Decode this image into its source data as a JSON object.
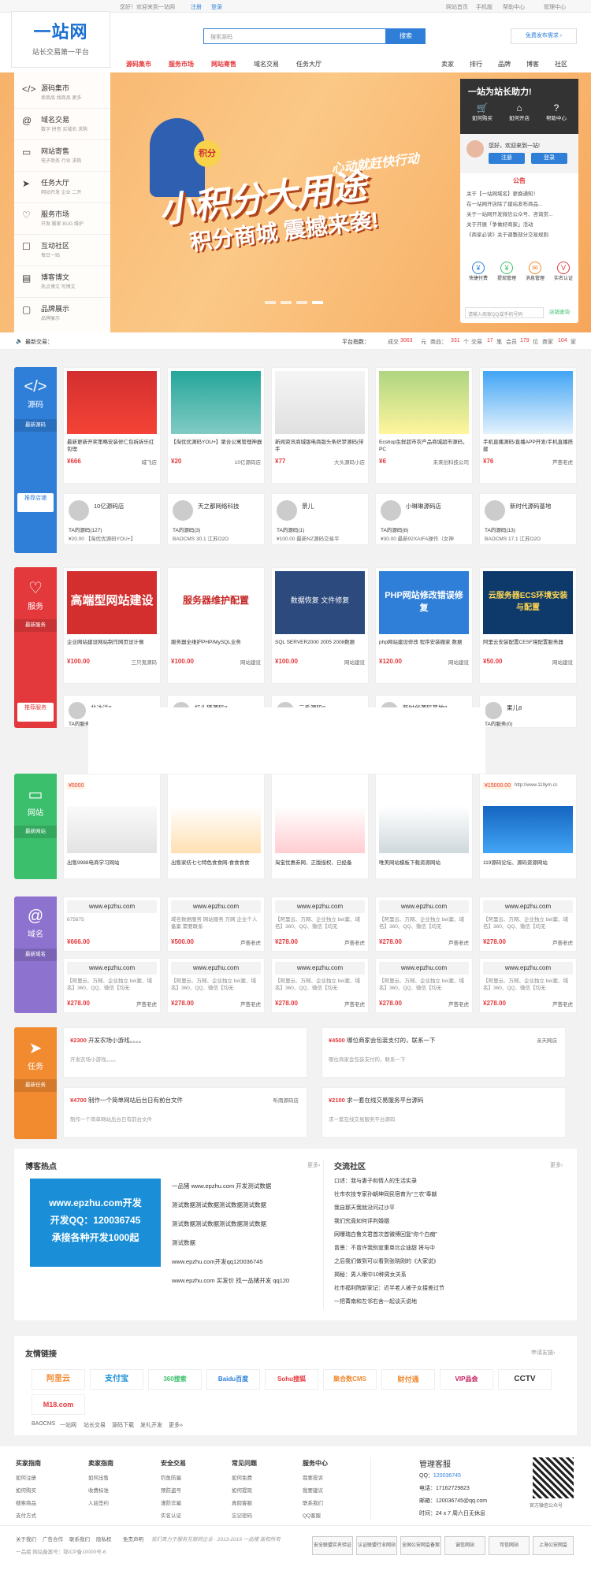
{
  "topbar": {
    "welcome": "您好！欢迎来到一站网",
    "login": "注册",
    "login2": "登录",
    "links": [
      "网站首页",
      "手机版",
      "帮助中心",
      "管理中心"
    ]
  },
  "logo": {
    "name": "一站网",
    "tagline": "站长交易第一平台"
  },
  "search": {
    "placeholder": "搜索源码",
    "button": "搜索",
    "publish": "免费发布需求 ›"
  },
  "nav": {
    "main": [
      "源码集市",
      "服务市场",
      "网站寄售",
      "域名交易",
      "任务大厅"
    ],
    "right": [
      "卖家",
      "排行",
      "品牌",
      "博客",
      "社区"
    ]
  },
  "side_menu": [
    {
      "title": "源码集市",
      "sub": "卖商品   找商品   更多",
      "icon": "code-icon"
    },
    {
      "title": "域名交易",
      "sub": "数字   拼音   买域名   求购",
      "icon": "at-icon"
    },
    {
      "title": "网站寄售",
      "sub": "电子商务   行业   求购",
      "icon": "monitor-icon"
    },
    {
      "title": "任务大厅",
      "sub": "网站开发   企业   二开",
      "icon": "send-icon"
    },
    {
      "title": "服务市场",
      "sub": "开发   搬家   BUG   维护",
      "icon": "heart-icon"
    },
    {
      "title": "互动社区",
      "sub": "每日一贴",
      "icon": "chat-icon"
    },
    {
      "title": "博客博文",
      "sub": "热点博文   写博文",
      "icon": "doc-icon"
    },
    {
      "title": "品牌展示",
      "sub": "品牌展示",
      "icon": "card-icon"
    }
  ],
  "banner": {
    "badge": "积分",
    "slogan1": "心动就赶快行动",
    "slogan2": "小积分大用途",
    "slogan3": "积分商城 震撼来袭!"
  },
  "right_panel": {
    "title": "一站为站长助力!",
    "tabs": [
      "如何购买",
      "如何开店",
      "帮助中心"
    ],
    "greeting": "您好，欢迎来到一站!",
    "reg": "注册",
    "login": "登录",
    "notice_title": "公告",
    "notices": [
      "关于【一站网域名】更换通知！",
      "在一站网开店除了建站发布商品...",
      "关于一站网开发微信公众号、咨询赏...",
      "关于开展「争做好商家」活动",
      "《商家必读》关于调整部分交易规则"
    ],
    "quick": [
      "快捷付费",
      "提现管理",
      "消息管理",
      "实名认证"
    ],
    "qq_tip": "请输入商家QQ或手机号码",
    "qq_btn": "店铺查询"
  },
  "ticker": {
    "label": "最新交易：",
    "stats_label": "平台指数：",
    "items": [
      "成交",
      "3063",
      "元",
      "商品：",
      "331",
      "个",
      "交易",
      "17",
      "笔",
      "会员",
      "179",
      "位",
      "商家",
      "104",
      "家"
    ]
  },
  "source": {
    "tag": "源码",
    "tag_sub": "最新源码",
    "shop_tag": "推荐店铺",
    "cards": [
      {
        "title": "最新更新开奖策略安装修仁包拆拆乐红包理",
        "price": "¥666",
        "seller": "城飞店"
      },
      {
        "title": "【淘优优源码YOU+】聚合公寓管理神器",
        "price": "¥20",
        "seller": "10亿源码店"
      },
      {
        "title": "新闻资讯商城版电商版头条织梦源码(带手",
        "price": "¥77",
        "seller": "大头源码小店"
      },
      {
        "title": "Ecshop生鲜超市农产品商城超市源码，PC",
        "price": "¥6",
        "seller": "未来创科技公司"
      },
      {
        "title": "手机直播源码/直播APP开发/手机直播搭建",
        "price": "¥76",
        "seller": "芦荟老虎"
      }
    ],
    "shops": [
      {
        "name": "10亿源码店",
        "count": "TA的源码(127)",
        "desc": "¥20.00 【淘优优源码YOU+】"
      },
      {
        "name": "天之都网络科技",
        "count": "TA的源码(3)",
        "desc": "BAOCMS 30.1 江苏O2O"
      },
      {
        "name": "景儿",
        "count": "TA的源码(1)",
        "desc": "¥100.00 最新NZ源码交易平"
      },
      {
        "name": "小琳琳源码店",
        "count": "TA的源码(8)",
        "desc": "¥30.00 最新92XAIFA操作（女神"
      },
      {
        "name": "新时代源码基地",
        "count": "TA的源码(13)",
        "desc": "BAOCMS 17.1 江苏O2O"
      }
    ]
  },
  "service": {
    "tag": "服务",
    "tag_sub": "最新服务",
    "shop_tag": "推荐服务",
    "cards": [
      {
        "title": "企业网站建设网站制作网页设计做",
        "price": "¥100.00",
        "seller": "三只鬼源码",
        "img": "高端型网站建设"
      },
      {
        "title": "服务器全维护PHP/MySQL业务",
        "price": "¥100.00",
        "seller": "网站建设",
        "img": "服务器维护配置"
      },
      {
        "title": "SQL SERVER2000 2005 2008数据",
        "price": "¥100.00",
        "seller": "网站建设",
        "img": "数据恢复 文件修复"
      },
      {
        "title": "php网站建设修改 程序安装搬家 数据",
        "price": "¥120.00",
        "seller": "网站建设",
        "img": "PHP网站修改错误修复"
      },
      {
        "title": "阿里云安装配置CESF境配置服务器",
        "price": "¥50.00",
        "seller": "网站建设",
        "img": "云服务器ECS环境安装与配置"
      }
    ],
    "shops": [
      {
        "name": "北冰洋8",
        "count": "TA的服务(0)",
        "desc": ""
      },
      {
        "name": "杠头猪源码8",
        "count": "",
        "desc": ""
      },
      {
        "name": "三毛源码8",
        "count": "",
        "desc": ""
      },
      {
        "name": "新时代源码基地8",
        "count": "",
        "desc": ""
      },
      {
        "name": "果儿8",
        "count": "TA的服务(0)",
        "desc": ""
      }
    ]
  },
  "website": {
    "tag": "网站",
    "tag_sub": "最新网站",
    "cards": [
      {
        "title": "出售9988电商学习网站",
        "price": "¥5000",
        "seller": ""
      },
      {
        "title": "出售家纺七七特色食食网-食食食食",
        "price": "",
        "seller": ""
      },
      {
        "title": "淘宝优惠券网、正版授权、已经备",
        "price": "",
        "seller": ""
      },
      {
        "title": "唯美网站模板下载资源网站",
        "price": "",
        "seller": ""
      },
      {
        "title": "119源码论坛、源码资源网站",
        "price": "¥15000.00",
        "seller": "http://www.119ym.cc"
      }
    ]
  },
  "domain": {
    "tag": "域名",
    "tag_sub": "最新域名",
    "row1": [
      {
        "name": "www.epzhu.com",
        "desc": "675675",
        "price": "¥666.00",
        "seller": ""
      },
      {
        "name": "www.epzhu.com",
        "desc": "域名数据服务 网站服务 万网 企业个人备案 需要联系",
        "price": "¥500.00",
        "seller": "芦荟老虎"
      },
      {
        "name": "www.epzhu.com",
        "desc": "【阿里云、万网、企业独立 bei案、域名】360、QQ、微信【均无",
        "price": "¥278.00",
        "seller": "芦荟老虎"
      },
      {
        "name": "www.epzhu.com",
        "desc": "【阿里云、万网、企业独立 bei案、域名】360、QQ、微信【均无",
        "price": "¥278.00",
        "seller": "芦荟老虎"
      },
      {
        "name": "www.epzhu.com",
        "desc": "【阿里云、万网、企业独立 bei案、域名】360、QQ、微信【均无",
        "price": "¥278.00",
        "seller": "芦荟老虎"
      }
    ],
    "row2": [
      {
        "name": "www.epzhu.com",
        "desc": "【阿里云、万网、企业独立 bei案、域名】360、QQ、微信【均无",
        "price": "¥278.00",
        "seller": "芦荟老虎"
      },
      {
        "name": "www.epzhu.com",
        "desc": "【阿里云、万网、企业独立 bei案、域名】360、QQ、微信【均无",
        "price": "¥278.00",
        "seller": "芦荟老虎"
      },
      {
        "name": "www.epzhu.com",
        "desc": "【阿里云、万网、企业独立 bei案、域名】360、QQ、微信【均无",
        "price": "¥278.00",
        "seller": "芦荟老虎"
      },
      {
        "name": "www.epzhu.com",
        "desc": "【阿里云、万网、企业独立 bei案、域名】360、QQ、微信【均无",
        "price": "¥278.00",
        "seller": "芦荟老虎"
      },
      {
        "name": "www.epzhu.com",
        "desc": "【阿里云、万网、企业独立 bei案、域名】360、QQ、微信【均无",
        "price": "¥278.00",
        "seller": "芦荟老虎"
      }
    ]
  },
  "task": {
    "tag": "任务",
    "tag_sub": "最新任务",
    "items": [
      {
        "price": "¥2300",
        "title": "开发农场小游戏。。。。",
        "desc": "开发农场小游戏。。。。",
        "seller": ""
      },
      {
        "price": "¥4500",
        "title": "哪位商家会包装支付的，联系一下",
        "desc": "哪位商家会包装支付的，联系一下",
        "seller": "亲天网店"
      },
      {
        "price": "¥4700",
        "title": "制作一个简单网站后台日有前台文件",
        "desc": "制作一个简单网站后台日有前台文件",
        "seller": "听雨源码店"
      },
      {
        "price": "¥2100",
        "title": "求一套在线交易服务平台源码",
        "desc": "求一套在线交易服务平台源码",
        "seller": ""
      }
    ]
  },
  "blog": {
    "title": "博客热点",
    "more": "更多›",
    "img_line1": "www.epzhu.com开发",
    "img_line2": "开发QQ：120036745",
    "img_line3": "承接各种开发1000起",
    "items": [
      "一品猪 www.epzhu.com 开发测试数据",
      "测试数据测试数据测试数据测试数据",
      "测试数据测试数据测试数据测试数据",
      "测试数据",
      "www.epzhu.com开发qq120036745",
      "www.epzhu.com 买发价 找一品猪开发 qq120"
    ]
  },
  "community": {
    "title": "交流社区",
    "more": "更多›",
    "items": [
      "口述：我与妻子和情人的生活实录",
      "社市农技专家孙朝坤同民宿育为“三农”奉献",
      "我自那天我就没问过沙平",
      "我们究竟如何评判婚姻",
      "网曝瑞白鲁文君首次首微博回复“你个白痴”",
      "曾景：不曾许我别宣重单比企迪甜 将与中",
      "之后我们做到可以看到张晓刚的《大家说》",
      "揭秘：男人眼中10种男女关系",
      "社市福利院新家记：近半老人被子女接差过节",
      "一把菁南和左邻右舍一起谈天说地"
    ]
  },
  "links": {
    "title": "友情链接",
    "more": "申请友链›",
    "logos": [
      "阿里云",
      "支付宝",
      "360搜索",
      "Baidu百度",
      "Sohu搜狐",
      "聚合数CMS",
      "财付通",
      "VIP品会",
      "CCTV",
      "M18.com"
    ],
    "text": [
      "BAOCMS",
      "一站网",
      "站长交易",
      "源码下载",
      "发礼开发",
      "更多»"
    ]
  },
  "footer": {
    "cols": [
      {
        "title": "买家指南",
        "items": [
          "如何注册",
          "如何购买",
          "搜索商品",
          "支付方式"
        ]
      },
      {
        "title": "卖家指南",
        "items": [
          "如何出售",
          "收费标准",
          "入驻签约"
        ]
      },
      {
        "title": "安全交易",
        "items": [
          "钓鱼防骗",
          "预防盗号",
          "谨防诈骗",
          "实名认证"
        ]
      },
      {
        "title": "常见问题",
        "items": [
          "如何免费",
          "如何提现",
          "真假客服",
          "忘记密码"
        ]
      },
      {
        "title": "服务中心",
        "items": [
          "我要投诉",
          "我要建议",
          "联系我们",
          "QQ客服"
        ]
      }
    ],
    "service_title": "管理客服",
    "service": [
      "QQ：",
      "120036745",
      "电话：",
      "17162729823",
      "邮箱：",
      "120036745@qq.com",
      "时间：",
      "24 x 7 周六日无休息"
    ],
    "qr_label": "官方微信公众号",
    "bottom_links": [
      "关于我们",
      "广告合作",
      "联系我们",
      "隐私权",
      "免责声明"
    ],
    "copyright": "我们青力于服务互联网企业 · 2013-2019 一品猪 版权所有",
    "icp": "一品猪 网站备案号：鄂ICP备10000号-6",
    "badges": [
      "安全联盟实名验证",
      "认证联盟行业网站",
      "全国公安网监备案",
      "诚信网站",
      "可信网站",
      "上海公安网监"
    ]
  },
  "colors": {
    "blue": "#2f7fd9",
    "red": "#e4393c",
    "orange": "#f28a30",
    "green": "#3cbf6c",
    "purple": "#8d72cf"
  }
}
